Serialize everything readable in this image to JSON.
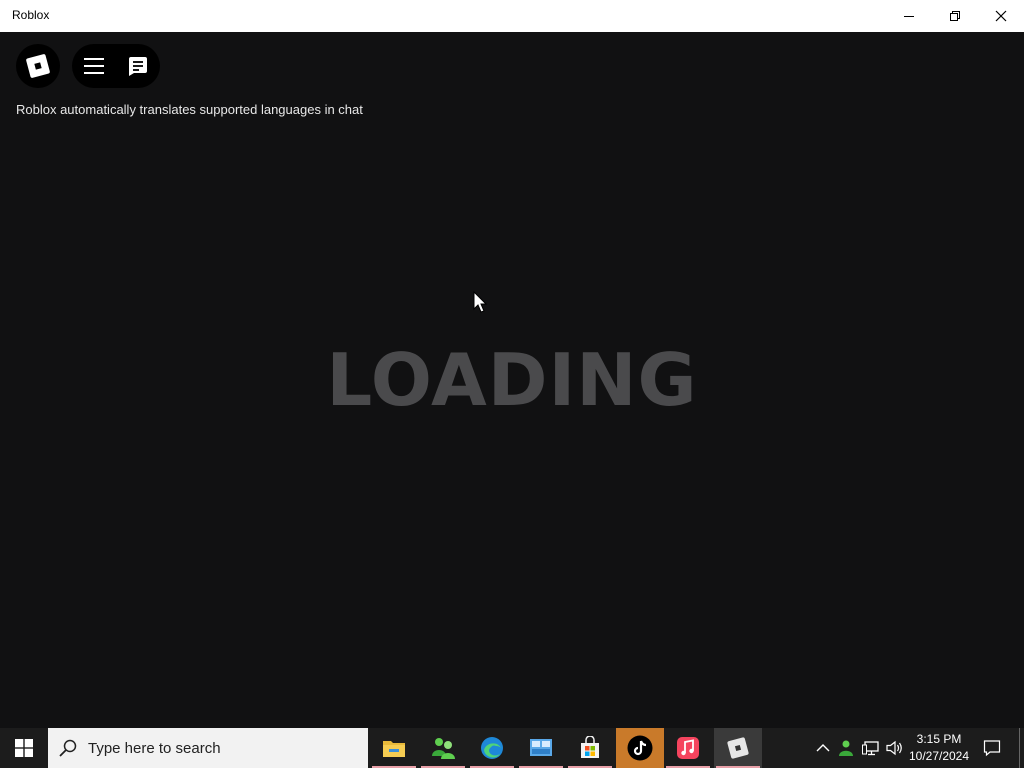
{
  "window": {
    "title": "Roblox",
    "controls": [
      "minimize-icon",
      "restore-icon",
      "close-icon"
    ]
  },
  "game": {
    "topbar": {
      "logo_icon": "roblox-logo-icon",
      "menu_icon": "hamburger-menu-icon",
      "chat_icon": "chat-icon"
    },
    "notice": "Roblox automatically translates supported languages in chat",
    "loading_text": "LOADING"
  },
  "taskbar": {
    "start_icon": "windows-start-icon",
    "search_placeholder": "Type here to search",
    "apps": [
      {
        "name": "file-explorer-icon"
      },
      {
        "name": "people-app-icon"
      },
      {
        "name": "edge-browser-icon"
      },
      {
        "name": "control-panel-icon"
      },
      {
        "name": "microsoft-store-icon"
      },
      {
        "name": "tiktok-icon"
      },
      {
        "name": "apple-music-icon"
      },
      {
        "name": "roblox-taskbar-icon"
      }
    ],
    "tray": {
      "chevron_icon": "chevron-up-icon",
      "icons": [
        "user-status-icon",
        "network-icon",
        "volume-icon"
      ]
    },
    "clock": {
      "time": "3:15 PM",
      "date": "10/27/2024"
    },
    "notification_icon": "action-center-icon"
  },
  "colors": {
    "game_background": "#111112",
    "loading_text": "#4a4a4c",
    "taskbar": "#1c1c1c",
    "tiktok_highlight": "#c97a2a"
  }
}
